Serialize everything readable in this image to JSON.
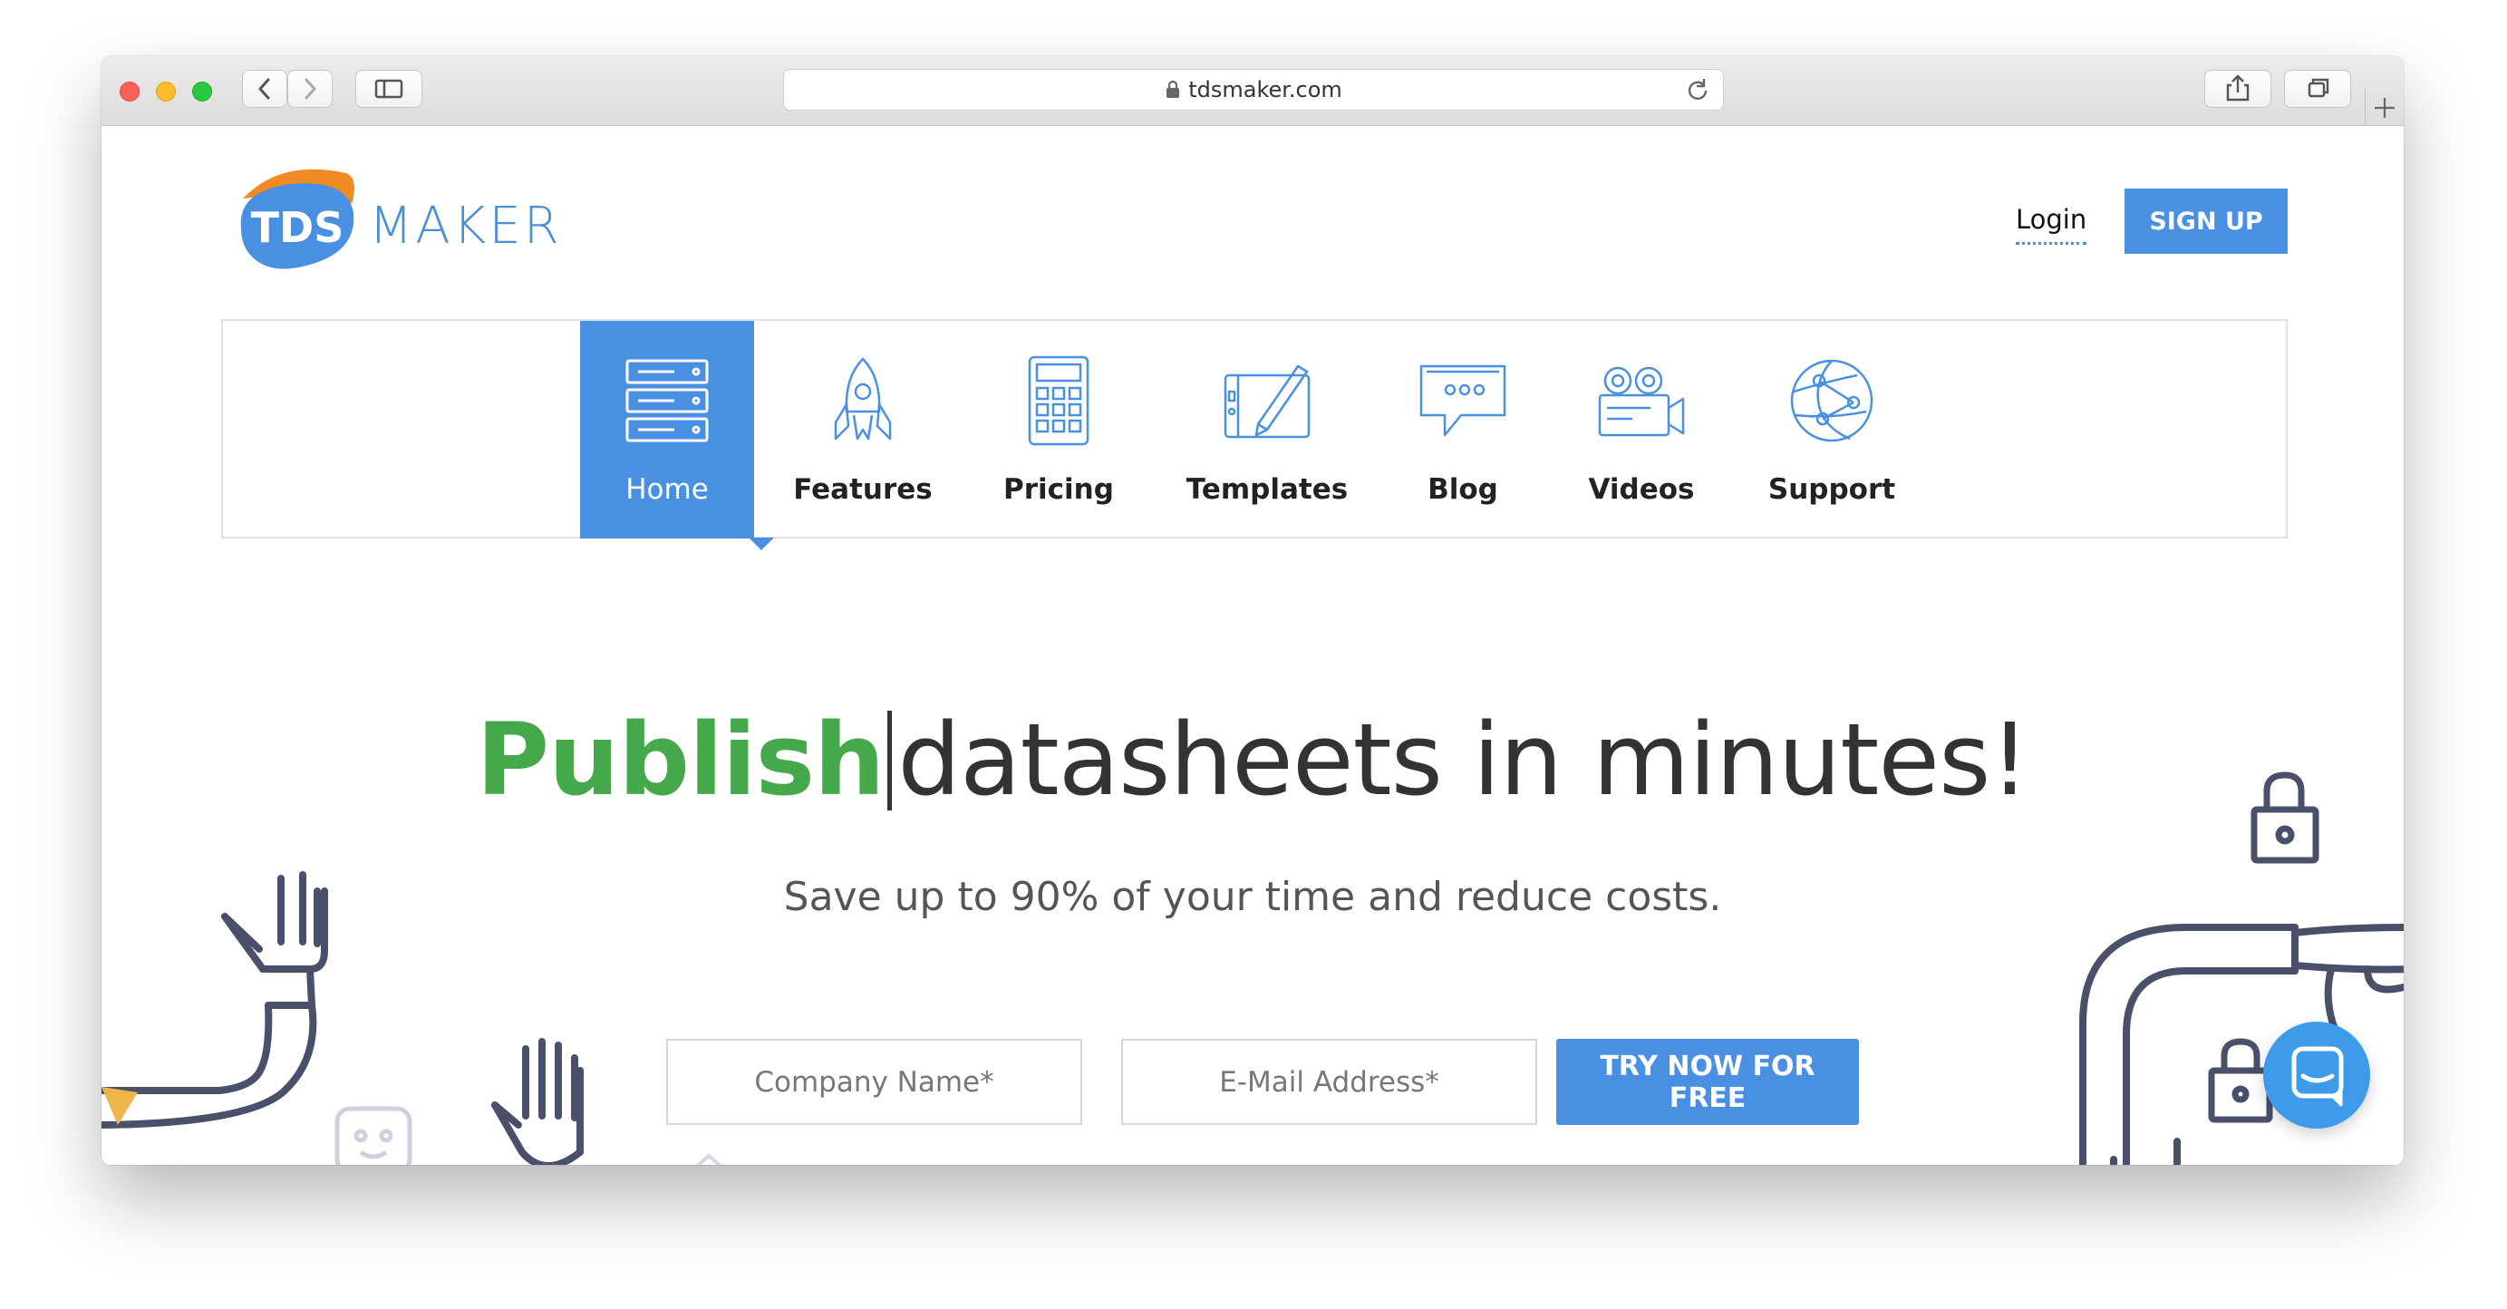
{
  "browser": {
    "url": "tdsmaker.com"
  },
  "header": {
    "logo_mark": "TDS",
    "logo_text": "MAKER",
    "login_label": "Login",
    "signup_label": "SIGN UP"
  },
  "nav": {
    "items": [
      {
        "label": "Home",
        "icon": "server-icon",
        "active": true
      },
      {
        "label": "Features",
        "icon": "rocket-icon",
        "active": false
      },
      {
        "label": "Pricing",
        "icon": "calculator-icon",
        "active": false
      },
      {
        "label": "Templates",
        "icon": "drawing-tablet-icon",
        "active": false
      },
      {
        "label": "Blog",
        "icon": "speech-bubble-icon",
        "active": false
      },
      {
        "label": "Videos",
        "icon": "video-camera-icon",
        "active": false
      },
      {
        "label": "Support",
        "icon": "network-globe-icon",
        "active": false
      }
    ]
  },
  "hero": {
    "headline_accent": "Publish",
    "headline_rest": "datasheets in minutes!",
    "subheadline": "Save up to 90% of your time and reduce costs."
  },
  "signup_form": {
    "company_placeholder": "Company Name*",
    "email_placeholder": "E-Mail Address*",
    "submit_label": "TRY NOW FOR FREE"
  },
  "colors": {
    "brand_blue": "#4a90e2",
    "accent_green": "#45a84b",
    "logo_orange": "#f08a24"
  }
}
